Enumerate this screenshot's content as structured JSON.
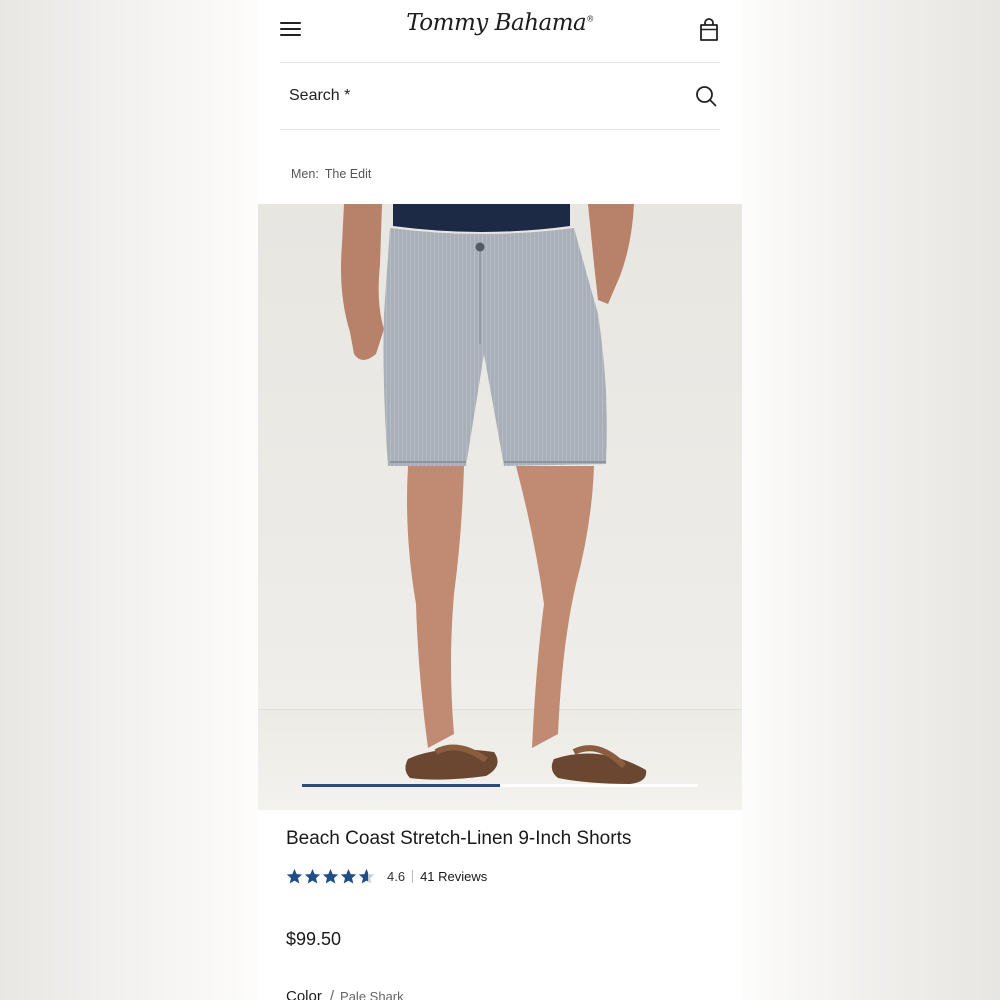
{
  "header": {
    "brand": "Tommy Bahama",
    "trademark": "®",
    "menu_icon": "hamburger-menu-icon",
    "bag_icon": "shopping-bag-icon"
  },
  "search": {
    "placeholder": "Search *",
    "icon": "search-icon"
  },
  "breadcrumb": {
    "parent": "Men:",
    "current": "The Edit"
  },
  "product": {
    "image_alt": "Man wearing gray linen shorts and brown flip-flops",
    "carousel_progress_fraction": 0.5,
    "title": "Beach Coast Stretch-Linen 9-Inch Shorts",
    "rating": {
      "value": "4.6",
      "out_of": 5,
      "numeric": 4.6,
      "reviews_label": "41 Reviews"
    },
    "price": "$99.50",
    "color_label": "Color",
    "color_value": "Pale Shark"
  },
  "colors": {
    "accent": "#2b4d7e",
    "star": "#1f4f86",
    "text": "#1a1a1a"
  }
}
